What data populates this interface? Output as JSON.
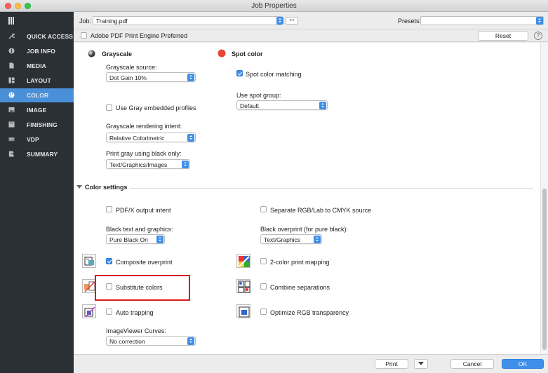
{
  "window": {
    "title": "Job Properties"
  },
  "sidebar": {
    "items": [
      {
        "label": "QUICK ACCESS",
        "icon": "wrench-icon"
      },
      {
        "label": "JOB INFO",
        "icon": "info-icon"
      },
      {
        "label": "MEDIA",
        "icon": "document-icon"
      },
      {
        "label": "LAYOUT",
        "icon": "layout-icon"
      },
      {
        "label": "COLOR",
        "icon": "palette-icon",
        "active": true
      },
      {
        "label": "IMAGE",
        "icon": "image-icon"
      },
      {
        "label": "FINISHING",
        "icon": "finishing-icon"
      },
      {
        "label": "VDP",
        "icon": "vdp-icon"
      },
      {
        "label": "SUMMARY",
        "icon": "summary-icon"
      }
    ]
  },
  "topbar": {
    "job_label": "Job:",
    "job_value": "Training.pdf",
    "presets_label": "Presets:",
    "presets_value": "",
    "adobe_pdf_label": "Adobe PDF Print Engine Preferred",
    "reset_label": "Reset",
    "help_label": "?"
  },
  "grayscale": {
    "title": "Grayscale",
    "source_label": "Grayscale source:",
    "source_value": "Dot Gain 10%",
    "use_gray_profiles_label": "Use Gray embedded profiles",
    "rendering_intent_label": "Grayscale rendering intent:",
    "rendering_intent_value": "Relative Colorimetric",
    "print_gray_label": "Print gray using black only:",
    "print_gray_value": "Text/Graphics/Images"
  },
  "spot": {
    "title": "Spot color",
    "matching_label": "Spot color matching",
    "group_label": "Use spot group:",
    "group_value": "Default"
  },
  "color_settings": {
    "section_title": "Color settings",
    "pdfx_label": "PDF/X output intent",
    "separate_rgb_label": "Separate RGB/Lab to CMYK source",
    "black_text_label": "Black text and graphics:",
    "black_text_value": "Pure Black On",
    "black_overprint_label": "Black overprint (for pure black):",
    "black_overprint_value": "Text/Graphics",
    "composite_overprint_label": "Composite overprint",
    "two_color_label": "2-color print mapping",
    "substitute_colors_label": "Substitute colors",
    "combine_separations_label": "Combine separations",
    "auto_trapping_label": "Auto trapping",
    "optimize_rgb_label": "Optimize RGB transparency",
    "imageviewer_label": "ImageViewer Curves:",
    "imageviewer_value": "No correction"
  },
  "bottombar": {
    "print_label": "Print",
    "cancel_label": "Cancel",
    "ok_label": "OK"
  },
  "colors": {
    "sidebar_bg": "#2b3035",
    "accent": "#3f8fe8",
    "spot_dot": "#e8473a",
    "highlight": "#d51c1c"
  }
}
